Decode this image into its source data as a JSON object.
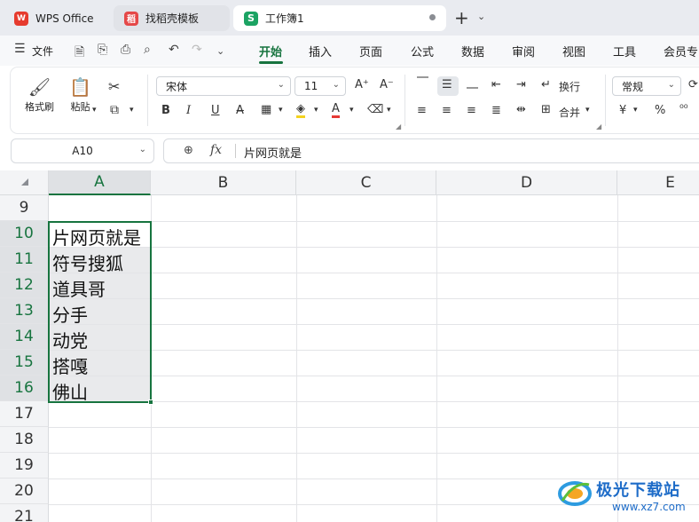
{
  "tabs": [
    {
      "label": "WPS Office",
      "logo": "W"
    },
    {
      "label": "找稻壳模板",
      "logo": "稻"
    },
    {
      "label": "工作簿1",
      "logo": "S"
    }
  ],
  "menu": {
    "file": "文件",
    "tabs": [
      "开始",
      "插入",
      "页面",
      "公式",
      "数据",
      "审阅",
      "视图",
      "工具",
      "会员专"
    ],
    "active_tab": "开始"
  },
  "ribbon": {
    "format_painter": "格式刷",
    "paste": "粘贴",
    "font_name": "宋体",
    "font_size": "11",
    "wrap_text": "换行",
    "merge": "合并",
    "number_format": "常规",
    "currency_symbol": "¥",
    "percent_symbol": "%"
  },
  "formula_bar": {
    "name_box": "A10",
    "fx": "fx",
    "content": "片网页就是"
  },
  "grid": {
    "columns": [
      "A",
      "B",
      "C",
      "D",
      "E"
    ],
    "selected_column": "A",
    "rows": [
      {
        "num": "9",
        "a": ""
      },
      {
        "num": "10",
        "a": "片网页就是"
      },
      {
        "num": "11",
        "a": "符号搜狐"
      },
      {
        "num": "12",
        "a": "道具哥"
      },
      {
        "num": "13",
        "a": "分手"
      },
      {
        "num": "14",
        "a": "动党"
      },
      {
        "num": "15",
        "a": "搭嘎"
      },
      {
        "num": "16",
        "a": "佛山"
      },
      {
        "num": "17",
        "a": ""
      },
      {
        "num": "18",
        "a": ""
      },
      {
        "num": "19",
        "a": ""
      },
      {
        "num": "20",
        "a": ""
      },
      {
        "num": "21",
        "a": ""
      }
    ]
  },
  "watermark": {
    "title": "极光下载站",
    "url": "www.xz7.com"
  },
  "colors": {
    "accent": "#17743f",
    "wps_red": "#e63b2e",
    "sheet_green": "#1ba363"
  }
}
